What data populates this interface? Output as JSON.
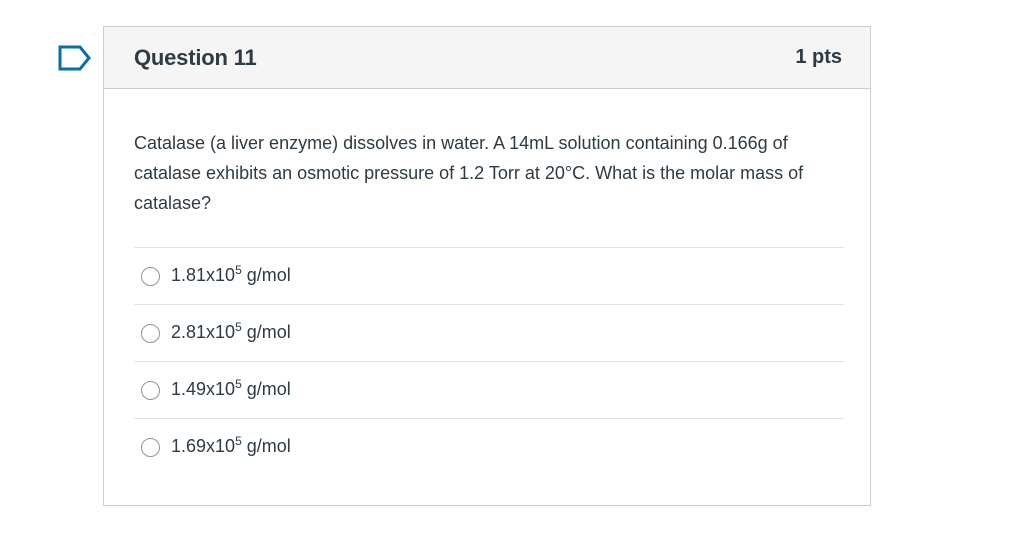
{
  "question": {
    "title": "Question 11",
    "points": "1 pts",
    "text": "Catalase (a liver enzyme) dissolves in water. A 14mL solution containing 0.166g of catalase exhibits an osmotic pressure of 1.2 Torr at 20°C. What is the molar mass of catalase?"
  },
  "answers": [
    {
      "base": "1.81x10",
      "exponent": "5",
      "unit": " g/mol"
    },
    {
      "base": "2.81x10",
      "exponent": "5",
      "unit": " g/mol"
    },
    {
      "base": "1.49x10",
      "exponent": "5",
      "unit": " g/mol"
    },
    {
      "base": "1.69x10",
      "exponent": "5",
      "unit": " g/mol"
    }
  ],
  "icons": {
    "flag": "flag-question-icon",
    "radio": "radio-button"
  },
  "colors": {
    "accent": "#0770a3",
    "text": "#2d3b45",
    "border": "#c7cdd1",
    "header_bg": "#f5f5f5"
  }
}
